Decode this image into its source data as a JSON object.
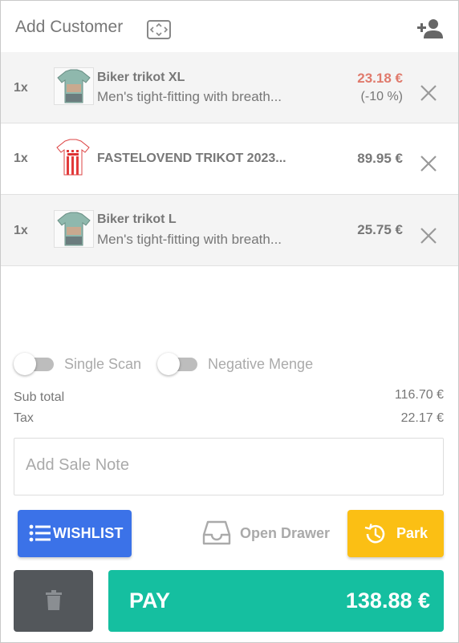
{
  "header": {
    "title": "Add Customer",
    "scan_icon": "barcode-scan-frame-icon",
    "add_customer_icon": "person-add-icon"
  },
  "cart": {
    "items": [
      {
        "qty": "1x",
        "name": "Biker trikot XL",
        "description": "Men's tight-fitting with breath...",
        "price": "23.18 €",
        "discount": "(-10 %)",
        "price_color": "#e07a6c",
        "thumbnail_icon": "biker-jersey-image"
      },
      {
        "qty": "1x",
        "name": "FASTELOVEND TRIKOT 2023...",
        "description": "",
        "price": "89.95 €",
        "thumbnail_icon": "red-white-striped-jersey-image"
      },
      {
        "qty": "1x",
        "name": "Biker trikot L",
        "description": "Men's tight-fitting with breath...",
        "price": "25.75 €",
        "thumbnail_icon": "biker-jersey-image"
      }
    ],
    "remove_icon": "close-icon"
  },
  "toggles": {
    "single_scan": {
      "label": "Single Scan",
      "on": false
    },
    "negative_menge": {
      "label": "Negative Menge",
      "on": false
    }
  },
  "totals": {
    "subtotal_label": "Sub total",
    "subtotal_value": "116.70 €",
    "tax_label": "Tax",
    "tax_value": "22.17 €"
  },
  "note": {
    "placeholder": "Add Sale Note",
    "value": ""
  },
  "actions": {
    "wishlist_label": "WISHLIST",
    "open_drawer_label": "Open Drawer",
    "park_label": "Park",
    "pay_label": "PAY",
    "pay_amount": "138.88 €"
  },
  "colors": {
    "wishlist": "#3b72e8",
    "park": "#fbbf14",
    "pay": "#15bfa0",
    "delete": "#53575b",
    "discount_price": "#e07a6c"
  }
}
